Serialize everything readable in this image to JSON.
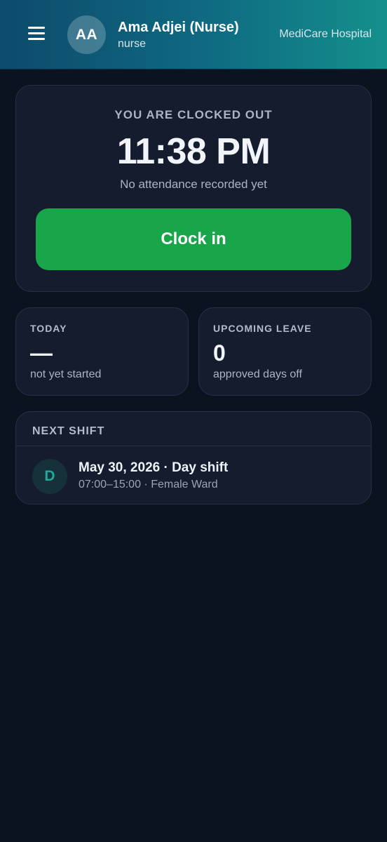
{
  "header": {
    "menu_icon": "hamburger-menu-icon",
    "avatar_initials": "AA",
    "user_name": "Ama Adjei (Nurse)",
    "user_role": "nurse",
    "hospital_name": "MediCare Hospital",
    "gradient_colors": [
      "#0d4a6b",
      "#14908c"
    ]
  },
  "clock": {
    "status": "YOU ARE CLOCKED OUT",
    "time": "11:38 PM",
    "note": "No attendance recorded yet",
    "button_label": "Clock in",
    "button_color": "#19a64a"
  },
  "stats": {
    "today": {
      "label": "TODAY",
      "value": "—",
      "sub": "not yet started"
    },
    "leave": {
      "label": "UPCOMING LEAVE",
      "value": "0",
      "sub": "approved days off"
    }
  },
  "next_shift": {
    "title": "NEXT SHIFT",
    "badge": "D",
    "date_line": "May 30, 2026 · Day shift",
    "detail_line": "07:00–15:00 · Female Ward",
    "badge_color": "#1ea99a"
  }
}
